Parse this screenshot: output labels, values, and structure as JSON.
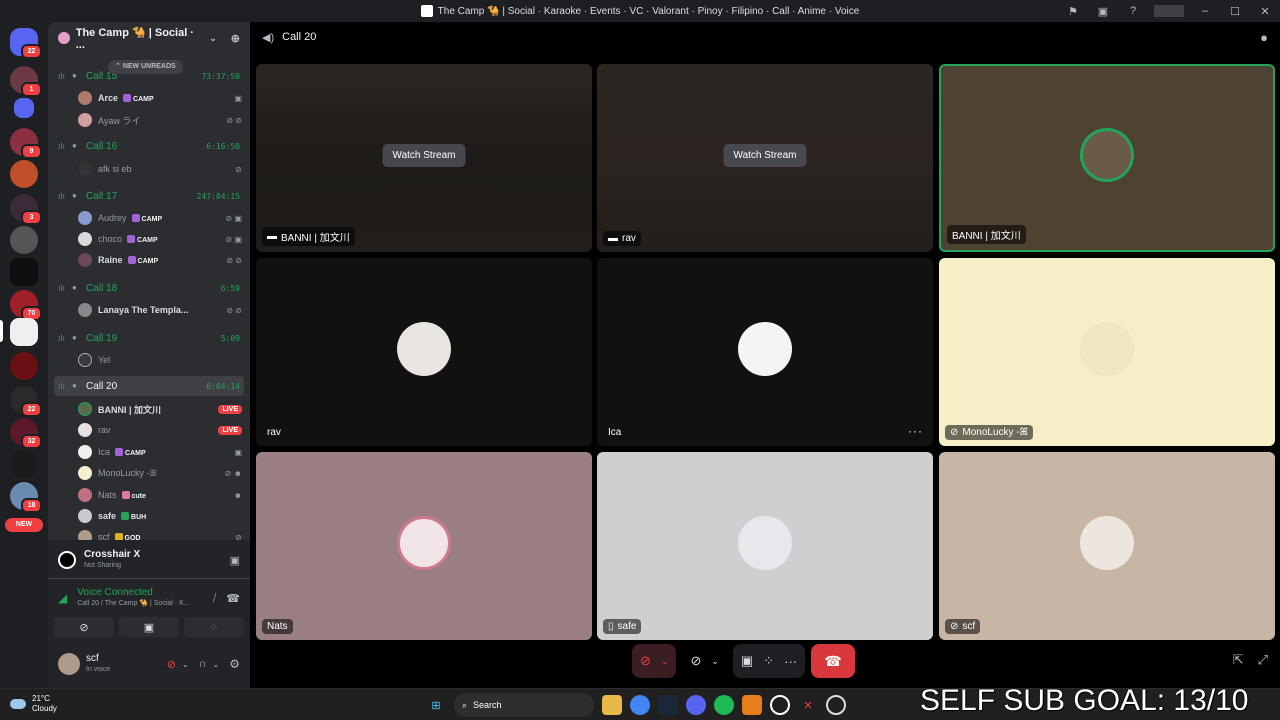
{
  "window": {
    "title": "The Camp 🐪 | Social · Karaoke · Events · VC · Valorant · Pinoy · Filipino · Call · Anime · Voice"
  },
  "rail": {
    "badges": [
      "22",
      "1",
      "9",
      "3",
      "70",
      "22",
      "32",
      "18"
    ],
    "new_label": "NEW"
  },
  "server": {
    "name": "The Camp 🐪 | Social · ..."
  },
  "new_unreads": "NEW UNREADS",
  "channels": [
    {
      "name": "Call 15",
      "timer": "73:37:50"
    },
    {
      "name": "Call 16",
      "timer": "6:16:50"
    },
    {
      "name": "Call 17",
      "timer": "247:04:15"
    },
    {
      "name": "Call 18",
      "timer": "6:59"
    },
    {
      "name": "Call 19",
      "timer": "5:09"
    },
    {
      "name": "Call 20",
      "timer": "6:04:14"
    }
  ],
  "users": {
    "c15": [
      {
        "name": "Arce",
        "tag": "CAMP"
      },
      {
        "name": "Ayaw ライ"
      }
    ],
    "c16": [
      {
        "name": "afk si eb"
      }
    ],
    "c17": [
      {
        "name": "Audrey",
        "tag": "CAMP"
      },
      {
        "name": "choco",
        "tag": "CAMP"
      },
      {
        "name": "Raine",
        "tag": "CAMP"
      }
    ],
    "c18": [
      {
        "name": "Lanaya The Templa..."
      }
    ],
    "c19": [
      {
        "name": "Yel"
      }
    ],
    "c20": [
      {
        "name": "BANNI | 加文川",
        "live": "LIVE"
      },
      {
        "name": "rav",
        "live": "LIVE"
      },
      {
        "name": "Ica",
        "tag": "CAMP"
      },
      {
        "name": "MonoLucky -ꕤ"
      },
      {
        "name": "Nats",
        "tag": "cute"
      },
      {
        "name": "safe",
        "tag": "BUH"
      },
      {
        "name": "scf",
        "tag": "GOD"
      }
    ]
  },
  "activity": {
    "name": "Crosshair X",
    "status": "Not Sharing"
  },
  "voice": {
    "status": "Voice Connected",
    "location": "Call 20 / The Camp 🐪 | Social · K..."
  },
  "me": {
    "name": "scf",
    "status": "In voice"
  },
  "main": {
    "channel": "Call 20"
  },
  "tiles": [
    {
      "name": "BANNI | 加文川",
      "watch": "Watch Stream"
    },
    {
      "name": "rav",
      "watch": "Watch Stream"
    },
    {
      "name": "BANNI | 加文川"
    },
    {
      "name": "rav"
    },
    {
      "name": "Ica"
    },
    {
      "name": "MonoLucky -ꕤ"
    },
    {
      "name": "Nats"
    },
    {
      "name": "safe"
    },
    {
      "name": "scf"
    }
  ],
  "taskbar": {
    "temp": "21°C",
    "weather": "Cloudy",
    "search": "Search"
  },
  "overlay": "SELF SUB GOAL: 13/10",
  "colors": {
    "accent_green": "#23a559",
    "live_red": "#f23f43",
    "bg": "#1e1f22"
  }
}
